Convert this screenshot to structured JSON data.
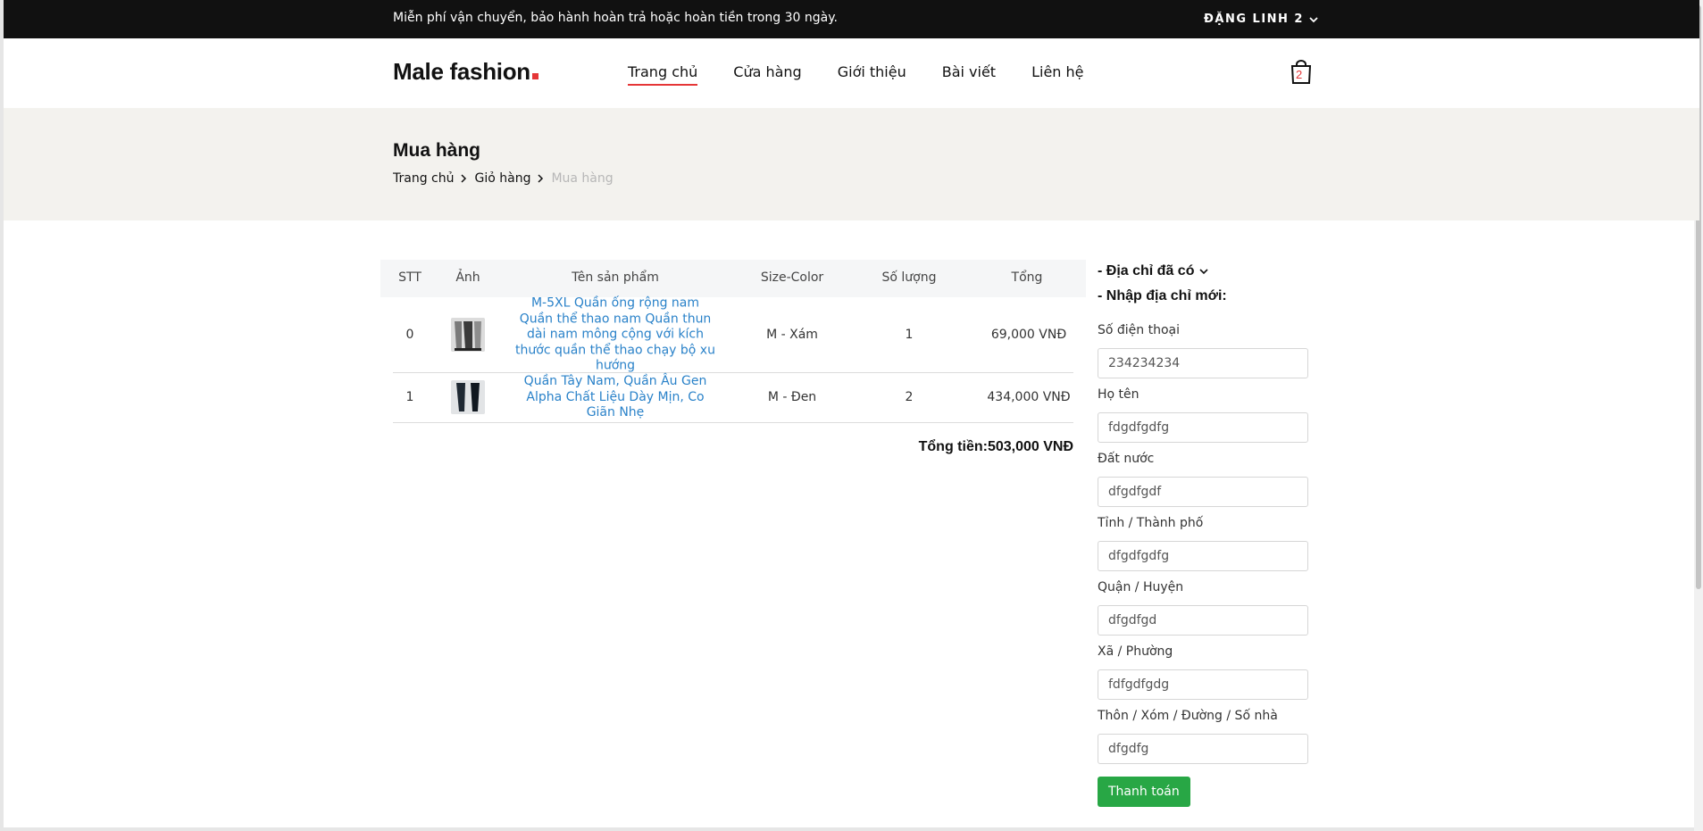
{
  "topbar": {
    "message": "Miễn phí vận chuyển, bảo hành hoàn trả hoặc hoàn tiền trong 30 ngày.",
    "account_label": "ĐẶNG LINH 2"
  },
  "nav": {
    "logo_text": "Male fashion",
    "menu": [
      {
        "label": "Trang chủ"
      },
      {
        "label": "Cửa hàng"
      },
      {
        "label": "Giới thiệu"
      },
      {
        "label": "Bài viết"
      },
      {
        "label": "Liên hệ"
      }
    ],
    "cart_count": "2"
  },
  "hero": {
    "title": "Mua hàng",
    "breadcrumb": [
      "Trang chủ",
      "Giỏ hàng",
      "Mua hàng"
    ]
  },
  "table": {
    "headers": [
      "STT",
      "Ảnh",
      "Tên sản phẩm",
      "Size-Color",
      "Số lượng",
      "Tổng"
    ],
    "rows": [
      {
        "stt": "0",
        "name": "M-5XL Quần ống rộng nam Quần thể thao nam Quần thun dài nam mông cộng với kích thước quần thể thao chạy bộ xu hướng",
        "size_color": "M - Xám",
        "quantity": "1",
        "total": "69,000 VNĐ"
      },
      {
        "stt": "1",
        "name": "Quần Tây Nam, Quần Âu Gen Alpha Chất Liệu Dày Mịn, Co Giãn Nhẹ",
        "size_color": "M - Đen",
        "quantity": "2",
        "total": "434,000 VNĐ"
      }
    ],
    "grand_total": "Tổng tiền:503,000 VNĐ"
  },
  "address": {
    "saved_label": "- Địa chỉ đã có",
    "new_label": "- Nhập địa chỉ mới:",
    "fields": [
      {
        "label": "Số điện thoại",
        "value": "234234234"
      },
      {
        "label": "Họ tên",
        "value": "fdgdfgdfg"
      },
      {
        "label": "Đất nước",
        "value": "dfgdfgdf"
      },
      {
        "label": "Tỉnh / Thành phố",
        "value": "dfgdfgdfg"
      },
      {
        "label": "Quận / Huyện",
        "value": "dfgdfgd"
      },
      {
        "label": "Xã / Phường",
        "value": "fdfgdfgdg"
      },
      {
        "label": "Thôn / Xóm / Đường / Số nhà",
        "value": "dfgdfg"
      }
    ],
    "submit_label": "Thanh toán"
  },
  "colors": {
    "accent": "#e53637",
    "link": "#2a82c9",
    "submit": "#28a745",
    "topbar": "#111111",
    "hero_bg": "#f3f2ee"
  }
}
